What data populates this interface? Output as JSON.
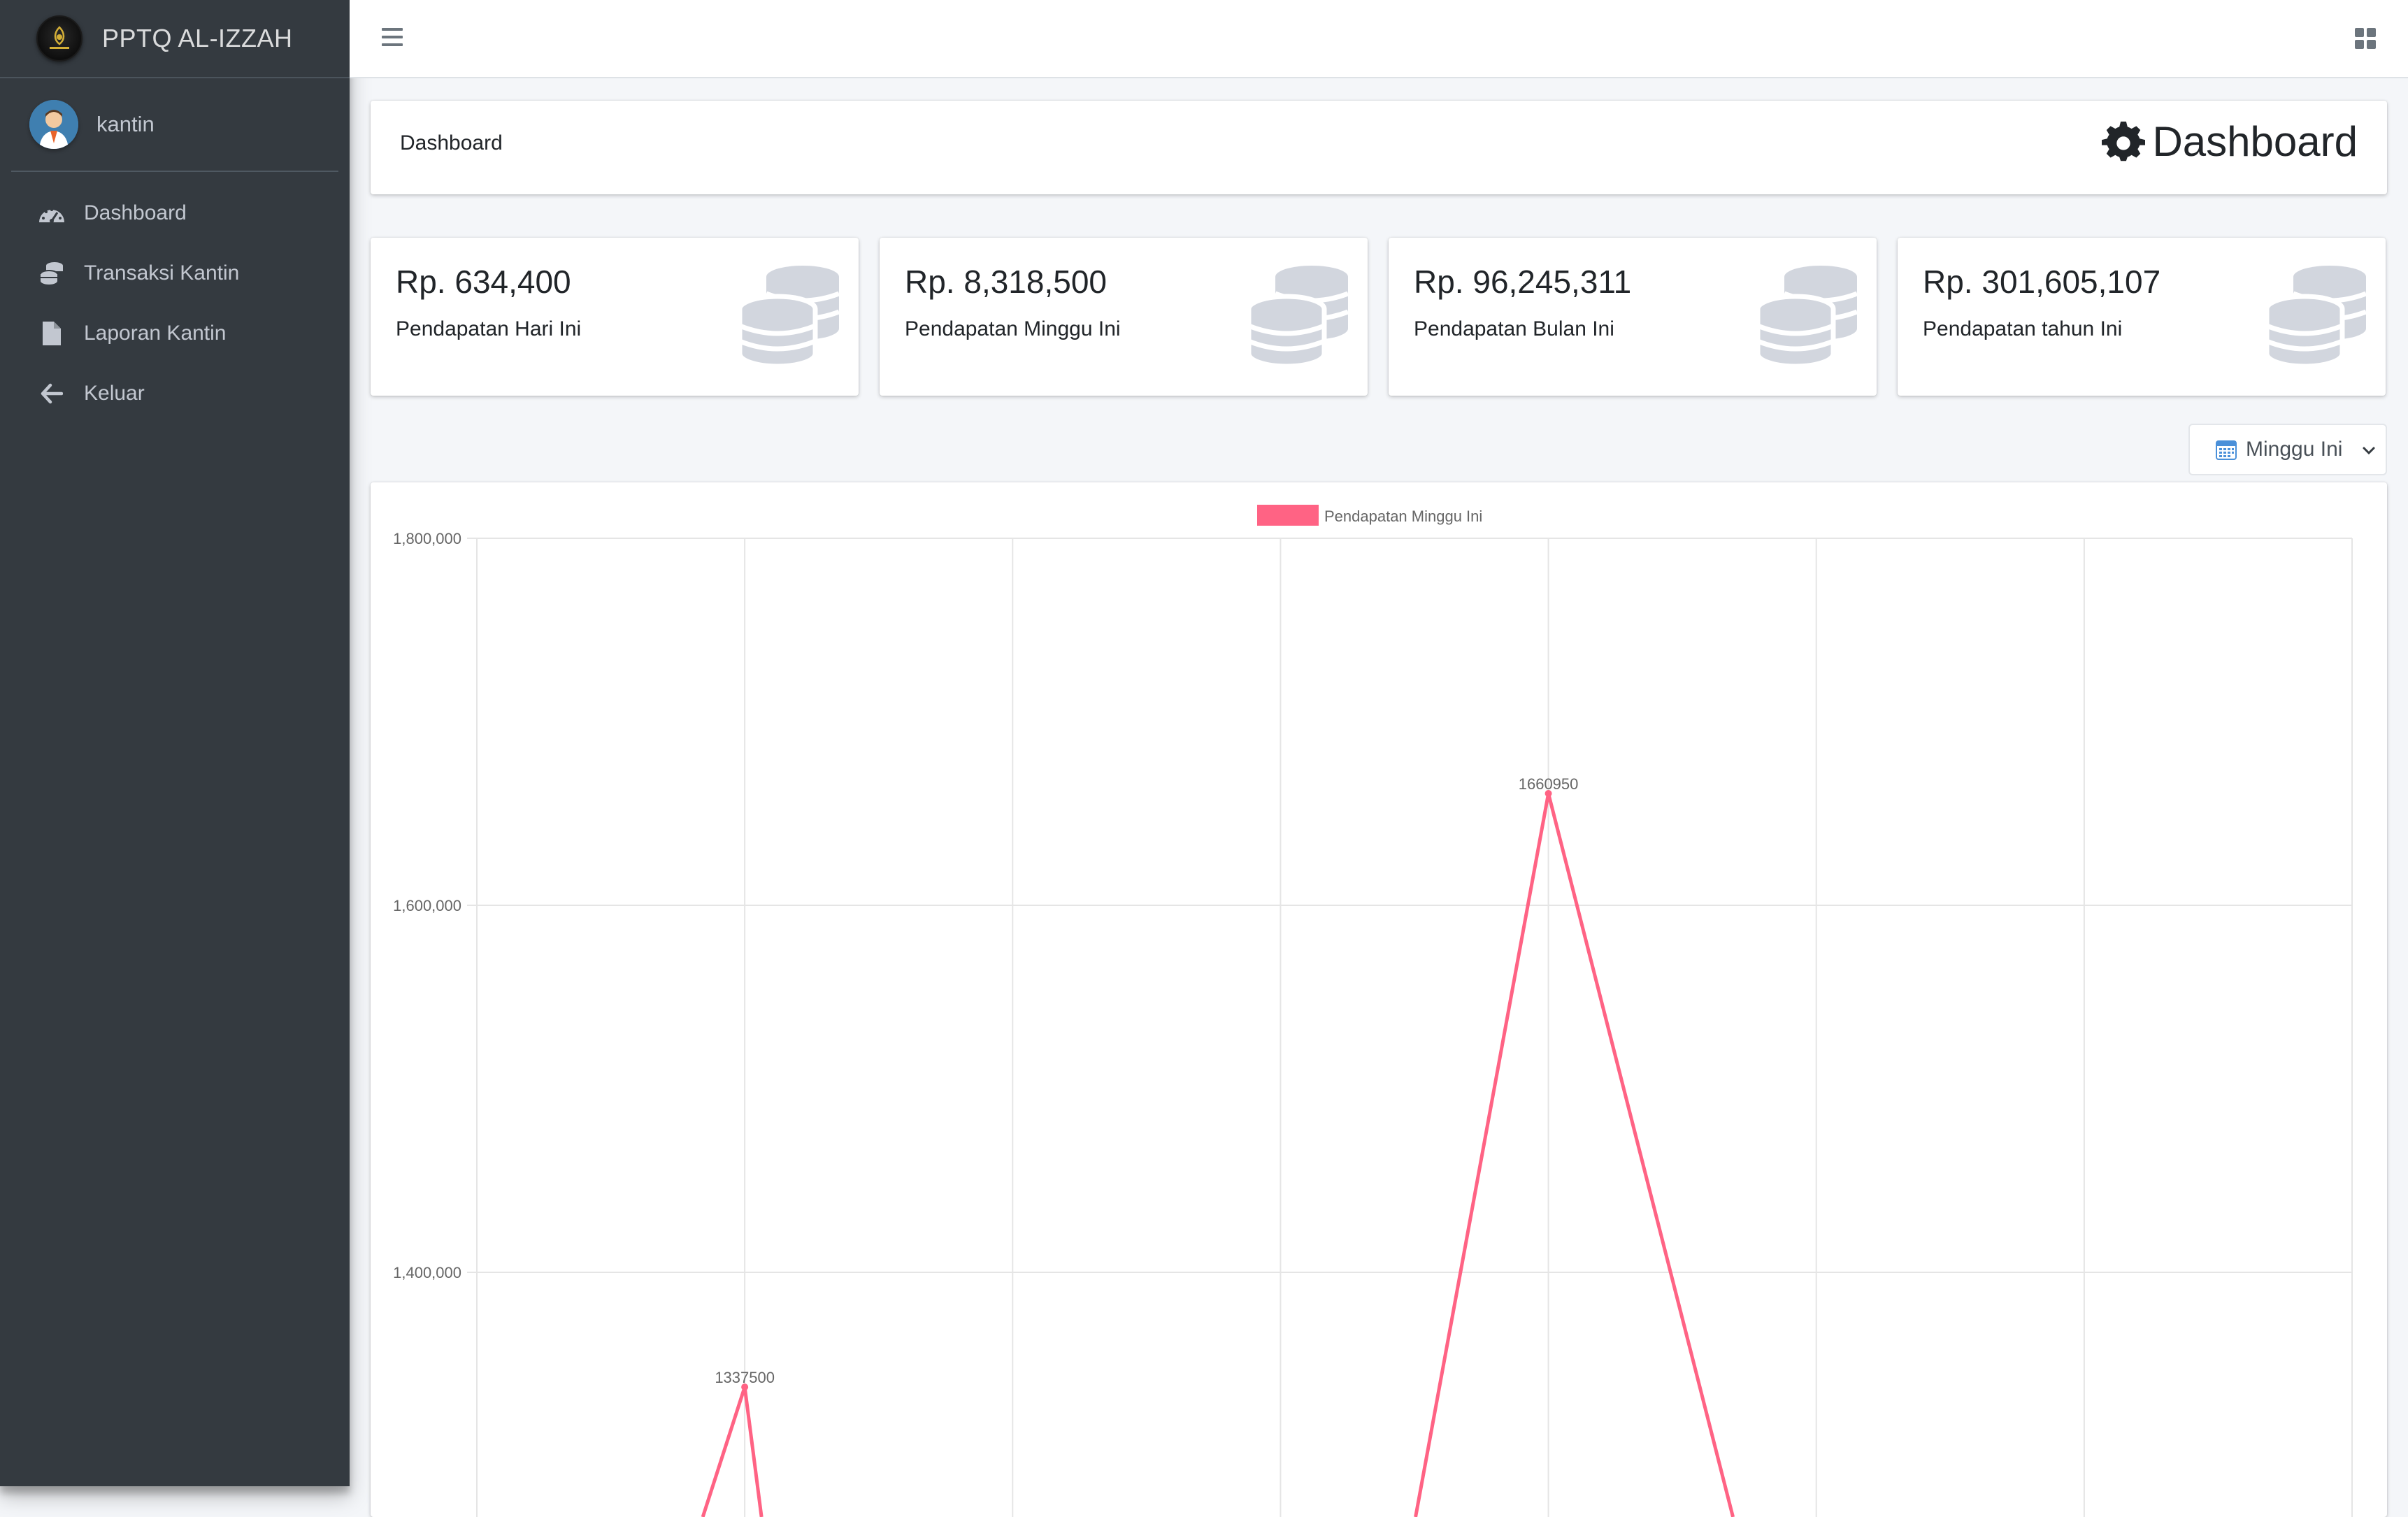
{
  "brand": {
    "name": "PPTQ AL-IZZAH"
  },
  "user": {
    "name": "kantin"
  },
  "sidebar": {
    "items": [
      {
        "label": "Dashboard",
        "icon": "dashboard-gauge-icon"
      },
      {
        "label": "Transaksi Kantin",
        "icon": "coins-icon"
      },
      {
        "label": "Laporan Kantin",
        "icon": "file-icon"
      },
      {
        "label": "Keluar",
        "icon": "arrow-left-icon"
      }
    ]
  },
  "header": {
    "breadcrumb": "Dashboard",
    "title": "Dashboard"
  },
  "stats": [
    {
      "value": "Rp. 634,400",
      "label": "Pendapatan Hari Ini"
    },
    {
      "value": "Rp. 8,318,500",
      "label": "Pendapatan Minggu Ini"
    },
    {
      "value": "Rp. 96,245,311",
      "label": "Pendapatan Bulan Ini"
    },
    {
      "value": "Rp. 301,605,107",
      "label": "Pendapatan tahun Ini"
    }
  ],
  "filter": {
    "selected": "Minggu Ini"
  },
  "colors": {
    "sidebar_bg": "#343a40",
    "line": "#ff6384",
    "coin_icon": "#d2d6de"
  },
  "chart_data": {
    "type": "line",
    "series": [
      {
        "name": "Pendapatan Minggu Ini",
        "color": "#ff6384"
      }
    ],
    "visible_points": [
      {
        "label": "1337500",
        "y": 1337500
      },
      {
        "label": "1660950",
        "y": 1660950
      }
    ],
    "y_ticks": [
      {
        "label": "1,800,000",
        "value": 1800000
      },
      {
        "label": "1,600,000",
        "value": 1600000
      },
      {
        "label": "1,400,000",
        "value": 1400000
      }
    ],
    "ylim_visible": [
      1200000,
      1800000
    ],
    "x_gridlines": 8,
    "grid": true,
    "legend_position": "top"
  }
}
